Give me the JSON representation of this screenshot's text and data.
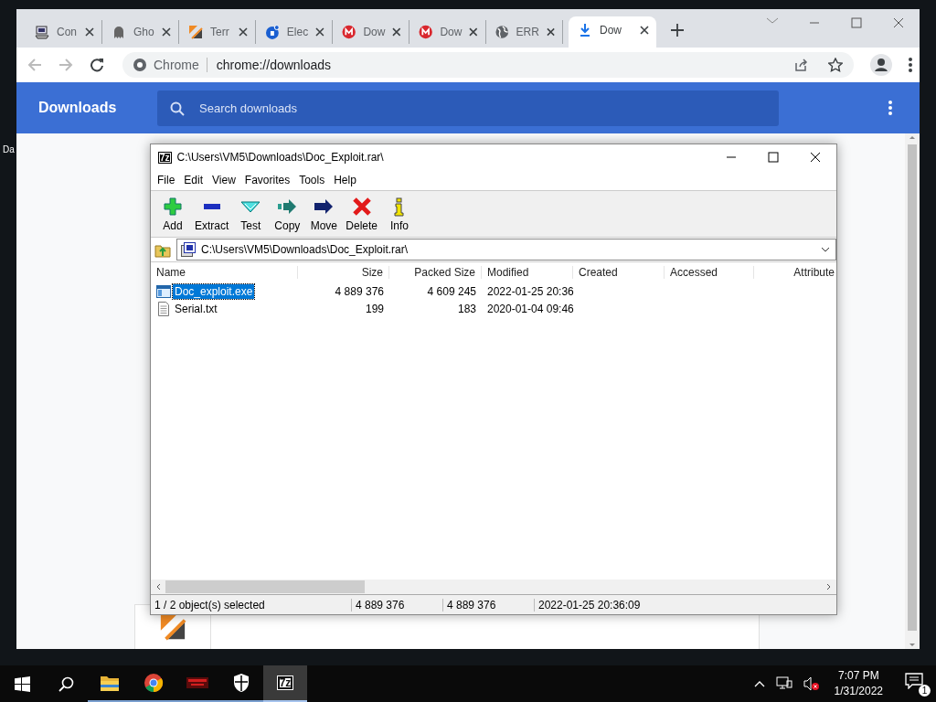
{
  "desktop": {
    "icon_label": "Da"
  },
  "browser": {
    "tabs": [
      {
        "title": "Con",
        "kind": "computer",
        "selected": false
      },
      {
        "title": "Gho",
        "kind": "ghost",
        "selected": false
      },
      {
        "title": "Terr",
        "kind": "slashes",
        "selected": false
      },
      {
        "title": "Elec",
        "kind": "badge",
        "selected": false
      },
      {
        "title": "Dow",
        "kind": "mega",
        "selected": false
      },
      {
        "title": "Dow",
        "kind": "mega",
        "selected": false
      },
      {
        "title": "ERR",
        "kind": "globe",
        "selected": false
      },
      {
        "title": "Dow",
        "kind": "download",
        "selected": true
      }
    ],
    "address": {
      "site_label": "Chrome",
      "url": "chrome://downloads"
    },
    "page": {
      "title": "Downloads",
      "search": {
        "placeholder": "Search downloads"
      }
    }
  },
  "archive_window": {
    "app_icon_text": "7z",
    "title": "C:\\Users\\VM5\\Downloads\\Doc_Exploit.rar\\",
    "menu": [
      "File",
      "Edit",
      "View",
      "Favorites",
      "Tools",
      "Help"
    ],
    "toolbar": [
      {
        "label": "Add",
        "kind": "add"
      },
      {
        "label": "Extract",
        "kind": "extract"
      },
      {
        "label": "Test",
        "kind": "test"
      },
      {
        "label": "Copy",
        "kind": "copy"
      },
      {
        "label": "Move",
        "kind": "move"
      },
      {
        "label": "Delete",
        "kind": "delete"
      },
      {
        "label": "Info",
        "kind": "info"
      }
    ],
    "path": "C:\\Users\\VM5\\Downloads\\Doc_Exploit.rar\\",
    "columns": [
      "Name",
      "Size",
      "Packed Size",
      "Modified",
      "Created",
      "Accessed",
      "Attribute"
    ],
    "rows": [
      {
        "name": "Doc_exploit.exe",
        "kind": "program",
        "size": "4 889 376",
        "packed_size": "4 609 245",
        "modified": "2022-01-25 20:36",
        "selected": true
      },
      {
        "name": "Serial.txt",
        "kind": "text",
        "size": "199",
        "packed_size": "183",
        "modified": "2020-01-04 09:46",
        "selected": false
      }
    ],
    "status_bar": [
      "1 / 2 object(s) selected",
      "4 889 376",
      "4 889 376",
      "2022-01-25 20:36:09"
    ]
  },
  "taskbar": {
    "apps": [
      {
        "kind": "folder",
        "selected": false
      },
      {
        "kind": "chrome",
        "selected": false
      },
      {
        "kind": "red-app",
        "selected": false
      },
      {
        "kind": "shield",
        "selected": false
      },
      {
        "kind": "archiver",
        "label": "7z",
        "selected": true
      }
    ],
    "time": "7:07 PM",
    "date": "1/31/2022",
    "notification_count": "1"
  }
}
